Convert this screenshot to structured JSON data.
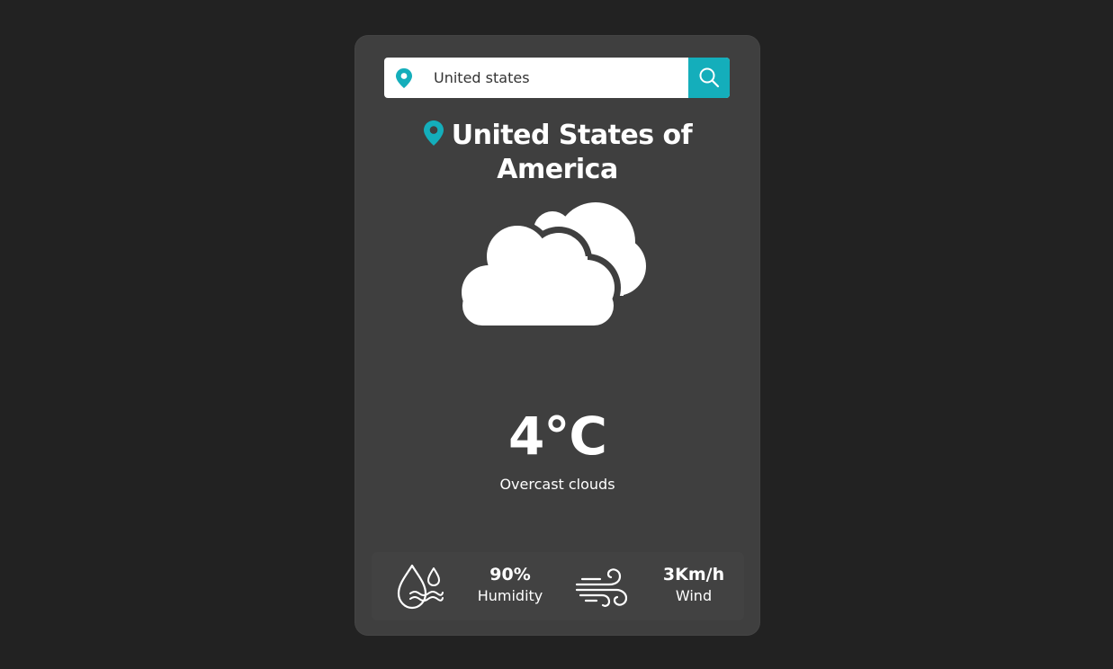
{
  "search": {
    "value": "United states",
    "icon": "map-pin-icon",
    "button_icon": "search-icon"
  },
  "location": {
    "name": "United States of America",
    "icon": "map-pin-icon"
  },
  "weather": {
    "icon": "cloud-icon",
    "temperature": "4°C",
    "description": "Overcast clouds"
  },
  "stats": {
    "humidity": {
      "value": "90%",
      "label": "Humidity",
      "icon": "humidity-icon"
    },
    "wind": {
      "value": "3Km/h",
      "label": "Wind",
      "icon": "wind-icon"
    }
  },
  "colors": {
    "background": "#222222",
    "card": "#3f3f3f",
    "accent": "#14aebb",
    "text": "#ffffff"
  }
}
